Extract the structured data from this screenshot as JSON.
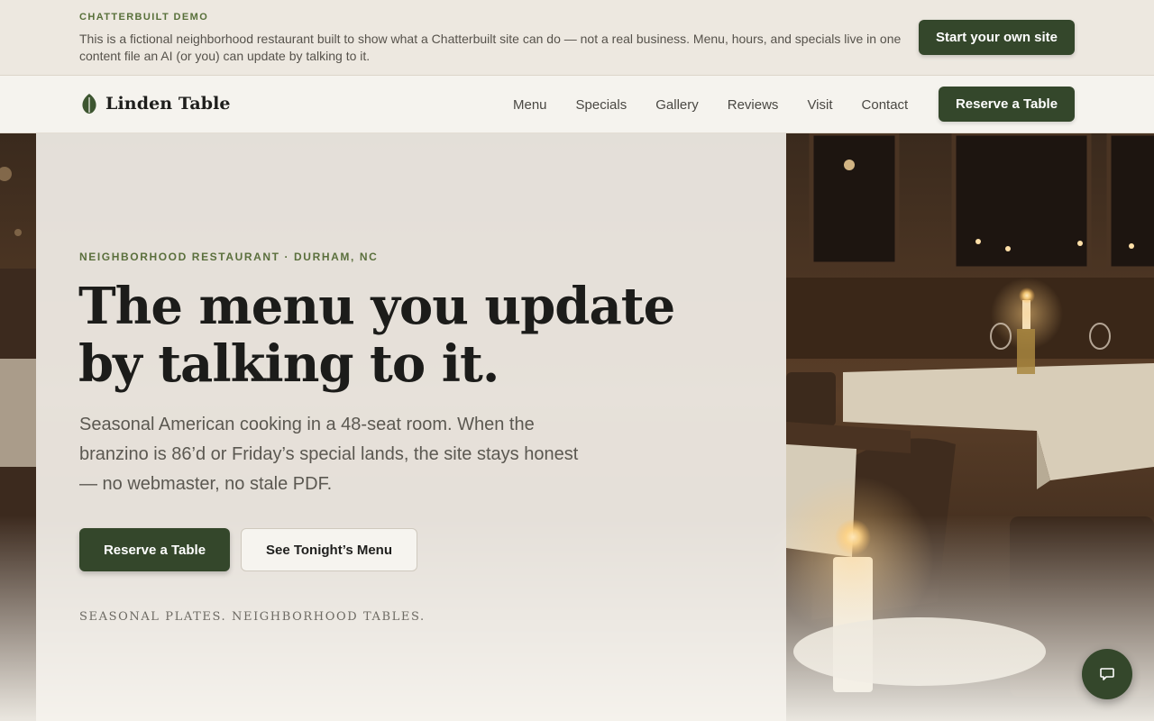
{
  "demo_banner": {
    "eyebrow": "CHATTERBUILT DEMO",
    "text": "This is a fictional neighborhood restaurant built to show what a Chatterbuilt site can do — not a real business. Menu, hours, and specials live in one content file an AI (or you) can update by talking to it.",
    "cta_label": "Start your own site"
  },
  "nav": {
    "brand": "Linden Table",
    "links": [
      {
        "label": "Menu"
      },
      {
        "label": "Specials"
      },
      {
        "label": "Gallery"
      },
      {
        "label": "Reviews"
      },
      {
        "label": "Visit"
      },
      {
        "label": "Contact"
      }
    ],
    "cta_label": "Reserve a Table"
  },
  "hero": {
    "eyebrow": "NEIGHBORHOOD RESTAURANT · DURHAM, NC",
    "title": "The menu you update by talking to it.",
    "subtitle": "Seasonal American cooking in a 48-seat room. When the branzino is 86’d or Friday’s special lands, the site stays honest — no webmaster, no stale PDF.",
    "primary_cta": "Reserve a Table",
    "secondary_cta": "See Tonight’s Menu",
    "tagline": "SEASONAL PLATES. NEIGHBORHOOD TABLES."
  },
  "icons": {
    "logo": "leaf-icon",
    "chat": "chat-bubble-icon"
  },
  "colors": {
    "brand_green": "#34472b",
    "accent_olive": "#5a6f3c",
    "background": "#f4f1ea"
  }
}
